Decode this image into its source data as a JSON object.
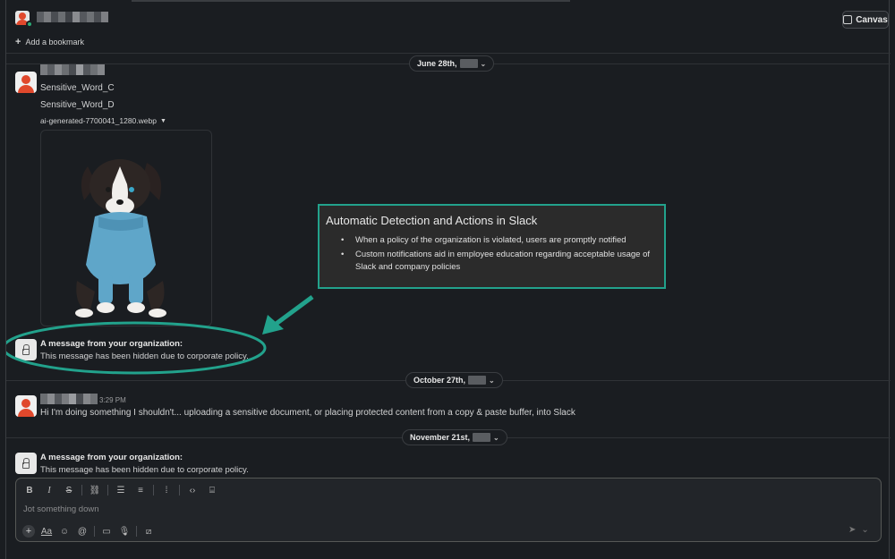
{
  "header": {
    "canvas_label": "Canvas",
    "bookmark_label": "Add a bookmark",
    "name_pixel_colors": [
      "#5b5e63",
      "#7a7c80",
      "#4a4d52",
      "#6b6e72",
      "#3f4247",
      "#8a8c90",
      "#55585d",
      "#6e7175",
      "#4b4e53",
      "#7d7f83"
    ]
  },
  "dividers": [
    {
      "date": "June 28th,"
    },
    {
      "date": "October 27th,"
    },
    {
      "date": "November 21st,"
    }
  ],
  "message1": {
    "name_pixel_colors": [
      "#7a7c80",
      "#5b5e63",
      "#8a8c90",
      "#6b6e72",
      "#4a4d52",
      "#9a9ca0",
      "#55585d",
      "#6e7175",
      "#85878b"
    ],
    "line1": "Sensitive_Word_C",
    "line2": "Sensitive_Word_D",
    "file_name": "ai-generated-7700041_1280.webp"
  },
  "hidden1": {
    "title": "A message from your organization:",
    "text": "This message has been hidden due to corporate policy."
  },
  "annotation": {
    "title": "Automatic Detection and Actions in Slack",
    "bullets": [
      "When a policy of the organization is violated, users are promptly notified",
      "Custom notifications aid in employee education regarding acceptable usage of Slack and company policies"
    ],
    "accent": "#22a28c"
  },
  "message2": {
    "name_pixel_colors": [
      "#6b6e72",
      "#8a8c90",
      "#55585d",
      "#7a7c80",
      "#9a9ca0",
      "#4a4d52",
      "#85878b",
      "#6e7175"
    ],
    "time": "3:29 PM",
    "text": "Hi I'm doing something I shouldn't... uploading a sensitive document, or placing protected content from a copy & paste buffer, into Slack"
  },
  "hidden2": {
    "title": "A message from your organization:",
    "text": "This message has been hidden due to corporate policy."
  },
  "composer": {
    "placeholder": "Jot something down",
    "toolbar": [
      "B",
      "I",
      "S",
      "link-icon",
      "ordered-list-icon",
      "bullet-list-icon",
      "blockquote-icon",
      "code-icon",
      "code-block-icon"
    ]
  }
}
